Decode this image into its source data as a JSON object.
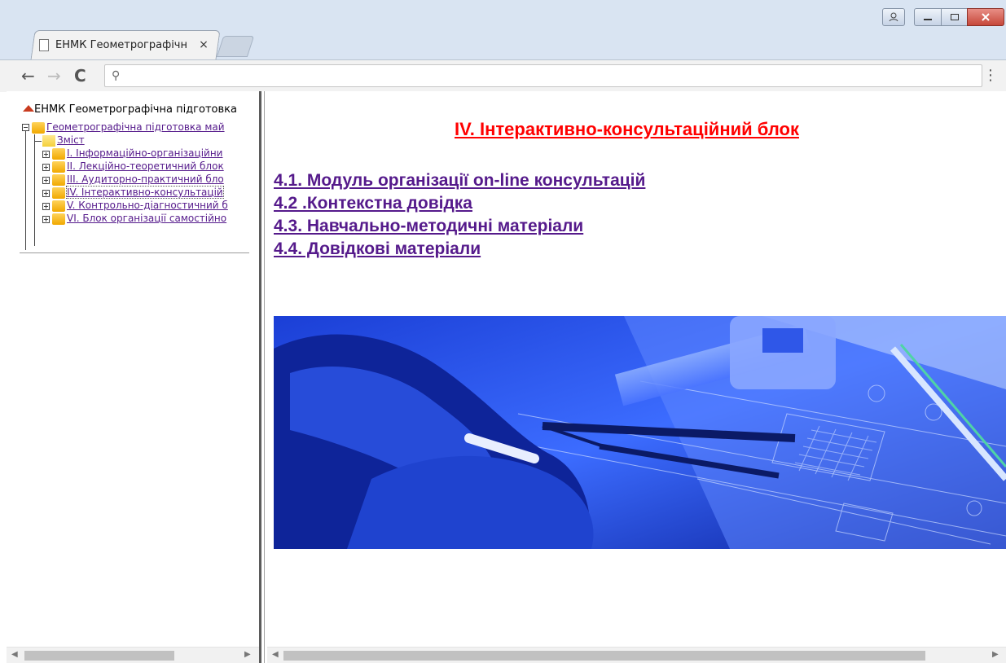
{
  "browser": {
    "tab_title": "ЕНМК Геометрографічн",
    "tab_close": "×",
    "address_text": "",
    "nav": {
      "back": "←",
      "forward": "→",
      "reload": "C",
      "search_glyph": "⚲",
      "menu": "⋮"
    }
  },
  "sidebar": {
    "root_label": "ЕНМК Геометрографічна підготовка",
    "section_label": "Геометрографічна підготовка май",
    "contents_label": "Зміст",
    "items": [
      {
        "label": "I. Інформаційно-організаційни"
      },
      {
        "label": "II. Лекційно-теоретичний блок"
      },
      {
        "label": "III. Аудиторно-практичний бло"
      },
      {
        "label": "IV. Інтерактивно-консультацій"
      },
      {
        "label": "V. Контрольно-діагностичний б"
      },
      {
        "label": "VI. Блок організації самостійно"
      }
    ]
  },
  "main": {
    "title": "IV. Інтерактивно-консультаційний блок",
    "links": [
      "4.1. Модуль організації on-line консультацій",
      "4.2 .Контекстна довідка",
      "4.3. Навчально-методичні матеріали",
      "4.4. Довідкові матеріали"
    ],
    "banner": "drafting-blueprint-photo"
  },
  "colors": {
    "title": "#ff0000",
    "link": "#551a8b",
    "banner_blue": "#2a4fe8"
  }
}
